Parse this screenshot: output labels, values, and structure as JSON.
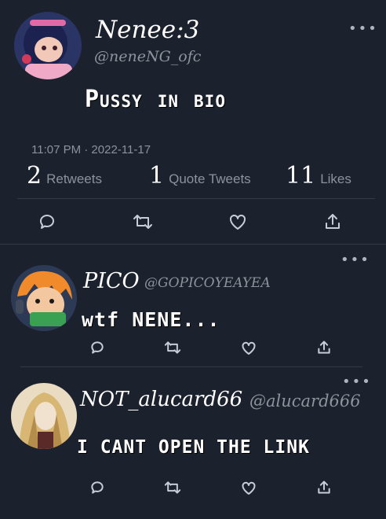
{
  "main_tweet": {
    "display_name": "Nenee:3",
    "handle": "@neneNG_ofc",
    "text": "Pussy in bio",
    "timestamp": "11:07 PM · 2022-11-17",
    "stats": {
      "retweets_count": "2",
      "retweets_label": "Retweets",
      "quotes_count": "1",
      "quotes_label": "Quote Tweets",
      "likes_count": "11",
      "likes_label": "Likes"
    },
    "more": "•••"
  },
  "replies": [
    {
      "display_name": "PICO",
      "handle": "@GOPICOYEAYEA",
      "text": "wtf NENE...",
      "more": "•••"
    },
    {
      "display_name": "NOT_alucard66",
      "handle": "@alucard666",
      "text": "I CANT OPEN THE LINK",
      "more": "•••"
    }
  ],
  "icons": [
    "reply-icon",
    "retweet-icon",
    "like-icon",
    "share-icon"
  ],
  "colors": {
    "background": "#1b212d",
    "muted": "#8b939e",
    "divider": "#323a47",
    "icon": "#c7cdd6"
  }
}
